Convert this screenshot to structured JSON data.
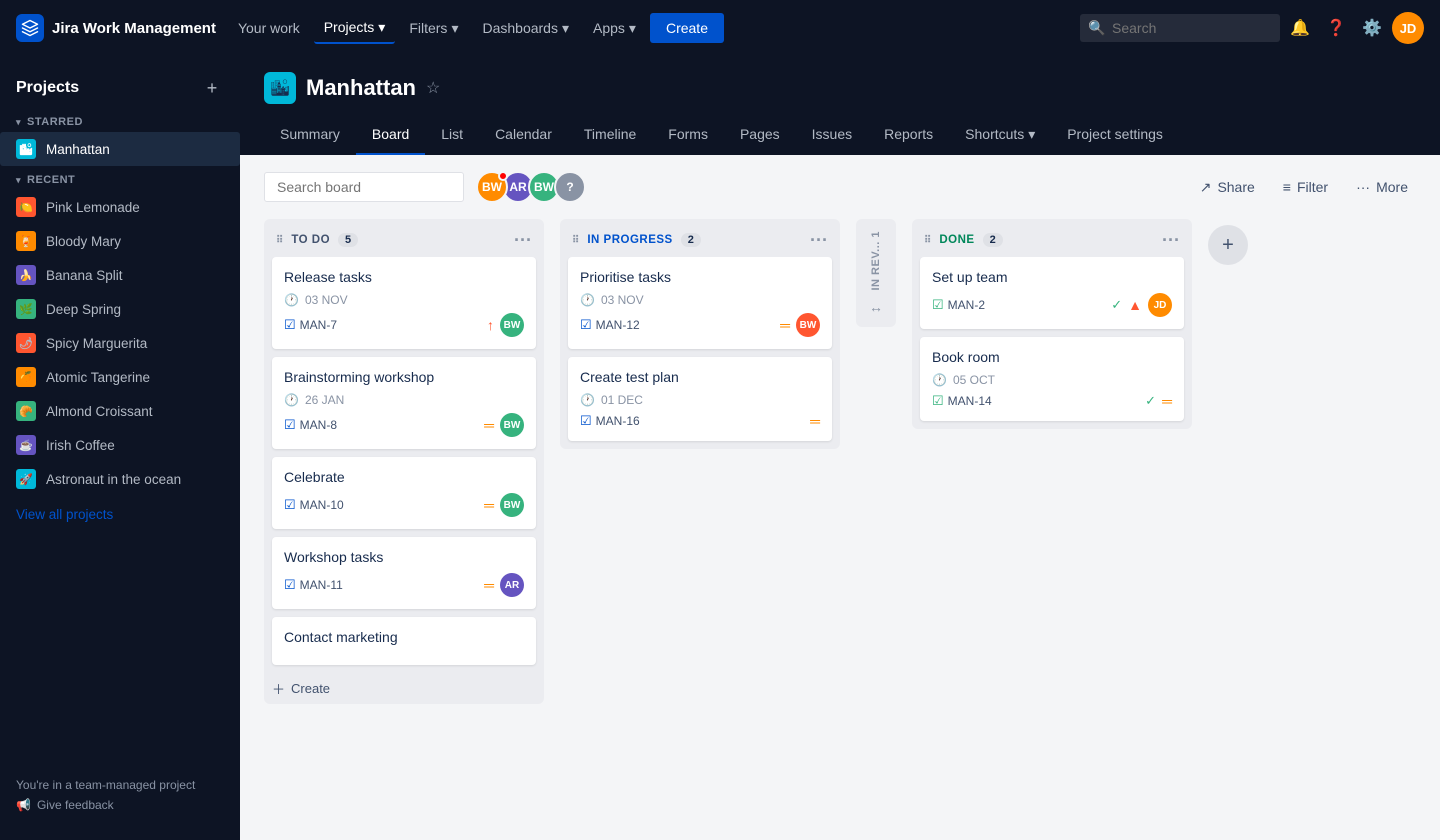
{
  "topnav": {
    "logo_text": "Jira Work Management",
    "logo_icon": "🔷",
    "nav_items": [
      {
        "label": "Your work",
        "active": false
      },
      {
        "label": "Projects",
        "active": true,
        "has_arrow": true
      },
      {
        "label": "Filters",
        "active": false,
        "has_arrow": true
      },
      {
        "label": "Dashboards",
        "active": false,
        "has_arrow": true
      },
      {
        "label": "Apps",
        "active": false,
        "has_arrow": true
      }
    ],
    "create_label": "Create",
    "search_placeholder": "Search"
  },
  "sidebar": {
    "title": "Projects",
    "add_btn": "+",
    "starred_label": "STARRED",
    "recent_label": "RECENT",
    "starred_items": [
      {
        "label": "Manhattan",
        "color": "#00b8d9",
        "icon": "🏙",
        "active": true
      }
    ],
    "recent_items": [
      {
        "label": "Pink Lemonade",
        "color": "#ff5630",
        "icon": "🍋"
      },
      {
        "label": "Bloody Mary",
        "color": "#ff8b00",
        "icon": "🍹"
      },
      {
        "label": "Banana Split",
        "color": "#6554c0",
        "icon": "🍌"
      },
      {
        "label": "Deep Spring",
        "color": "#36b37e",
        "icon": "🌿"
      },
      {
        "label": "Spicy Marguerita",
        "color": "#ff5630",
        "icon": "🌶"
      },
      {
        "label": "Atomic Tangerine",
        "color": "#ff8b00",
        "icon": "🍊"
      },
      {
        "label": "Almond Croissant",
        "color": "#36b37e",
        "icon": "🥐"
      },
      {
        "label": "Irish Coffee",
        "color": "#6554c0",
        "icon": "☕"
      },
      {
        "label": "Astronaut in the ocean",
        "color": "#00b8d9",
        "icon": "🚀"
      }
    ],
    "view_all_label": "View all projects",
    "team_note": "You're in a team-managed project",
    "feedback_label": "Give feedback"
  },
  "project": {
    "name": "Manhattan",
    "icon": "🏙",
    "icon_bg": "#00b8d9",
    "star_icon": "★",
    "tabs": [
      {
        "label": "Summary"
      },
      {
        "label": "Board",
        "active": true
      },
      {
        "label": "List"
      },
      {
        "label": "Calendar"
      },
      {
        "label": "Timeline"
      },
      {
        "label": "Forms"
      },
      {
        "label": "Pages"
      },
      {
        "label": "Issues"
      },
      {
        "label": "Reports"
      },
      {
        "label": "Shortcuts"
      },
      {
        "label": "Project settings"
      }
    ]
  },
  "board_toolbar": {
    "search_placeholder": "Search board",
    "share_label": "Share",
    "filter_label": "Filter",
    "more_label": "More",
    "avatars": [
      {
        "initials": "BW",
        "color": "#ff8b00",
        "has_red_dot": true
      },
      {
        "initials": "AR",
        "color": "#6554c0"
      },
      {
        "initials": "BW",
        "color": "#36b37e"
      },
      {
        "initials": "?",
        "color": "#8993a4"
      }
    ]
  },
  "board": {
    "columns": [
      {
        "id": "todo",
        "title": "TO DO",
        "count": 5,
        "type": "todo",
        "cards": [
          {
            "title": "Release tasks",
            "date": "03 NOV",
            "tag": "MAN-7",
            "priority": "high",
            "priority_icon": "↑",
            "priority_color": "#ff5630",
            "avatar_initials": "BW",
            "avatar_color": "#36b37e"
          },
          {
            "title": "Brainstorming workshop",
            "date": "26 JAN",
            "tag": "MAN-8",
            "priority": "medium",
            "priority_icon": "=",
            "priority_color": "#ff8b00",
            "avatar_initials": "BW",
            "avatar_color": "#36b37e"
          },
          {
            "title": "Celebrate",
            "date": null,
            "tag": "MAN-10",
            "priority": "medium",
            "priority_icon": "=",
            "priority_color": "#ff8b00",
            "avatar_initials": "BW",
            "avatar_color": "#36b37e"
          },
          {
            "title": "Workshop tasks",
            "date": null,
            "tag": "MAN-11",
            "priority": "medium",
            "priority_icon": "=",
            "priority_color": "#ff8b00",
            "avatar_initials": "AR",
            "avatar_color": "#6554c0"
          },
          {
            "title": "Contact marketing",
            "date": null,
            "tag": null,
            "priority": null,
            "priority_icon": null,
            "avatar_initials": null,
            "avatar_color": null
          }
        ],
        "add_label": "Create"
      },
      {
        "id": "inprogress",
        "title": "IN PROGRESS",
        "count": 2,
        "type": "inprogress",
        "cards": [
          {
            "title": "Prioritise tasks",
            "date": "03 NOV",
            "tag": "MAN-12",
            "priority": "medium",
            "priority_icon": "=",
            "priority_color": "#ff8b00",
            "avatar_initials": "BW",
            "avatar_color": "#ff5630"
          },
          {
            "title": "Create test plan",
            "date": "01 DEC",
            "tag": "MAN-16",
            "priority": "medium",
            "priority_icon": "=",
            "priority_color": "#ff8b00",
            "avatar_initials": null,
            "avatar_color": null
          }
        ],
        "add_label": null
      }
    ],
    "vertical_column": {
      "title": "IN REV...",
      "count": 1,
      "expand_icon": "↔"
    },
    "done_column": {
      "title": "DONE",
      "count": 2,
      "cards": [
        {
          "title": "Set up team",
          "tag": "MAN-2",
          "has_check": true,
          "priority_icon": "↑",
          "priority_color": "#ff5630",
          "avatar_initials": "JD",
          "avatar_color": "#ff8b00",
          "date": null
        },
        {
          "title": "Book room",
          "date": "05 OCT",
          "tag": "MAN-14",
          "has_check": true,
          "priority_icon": "=",
          "priority_color": "#ff8b00",
          "avatar_initials": null,
          "avatar_color": null
        }
      ]
    },
    "add_column_icon": "+"
  }
}
